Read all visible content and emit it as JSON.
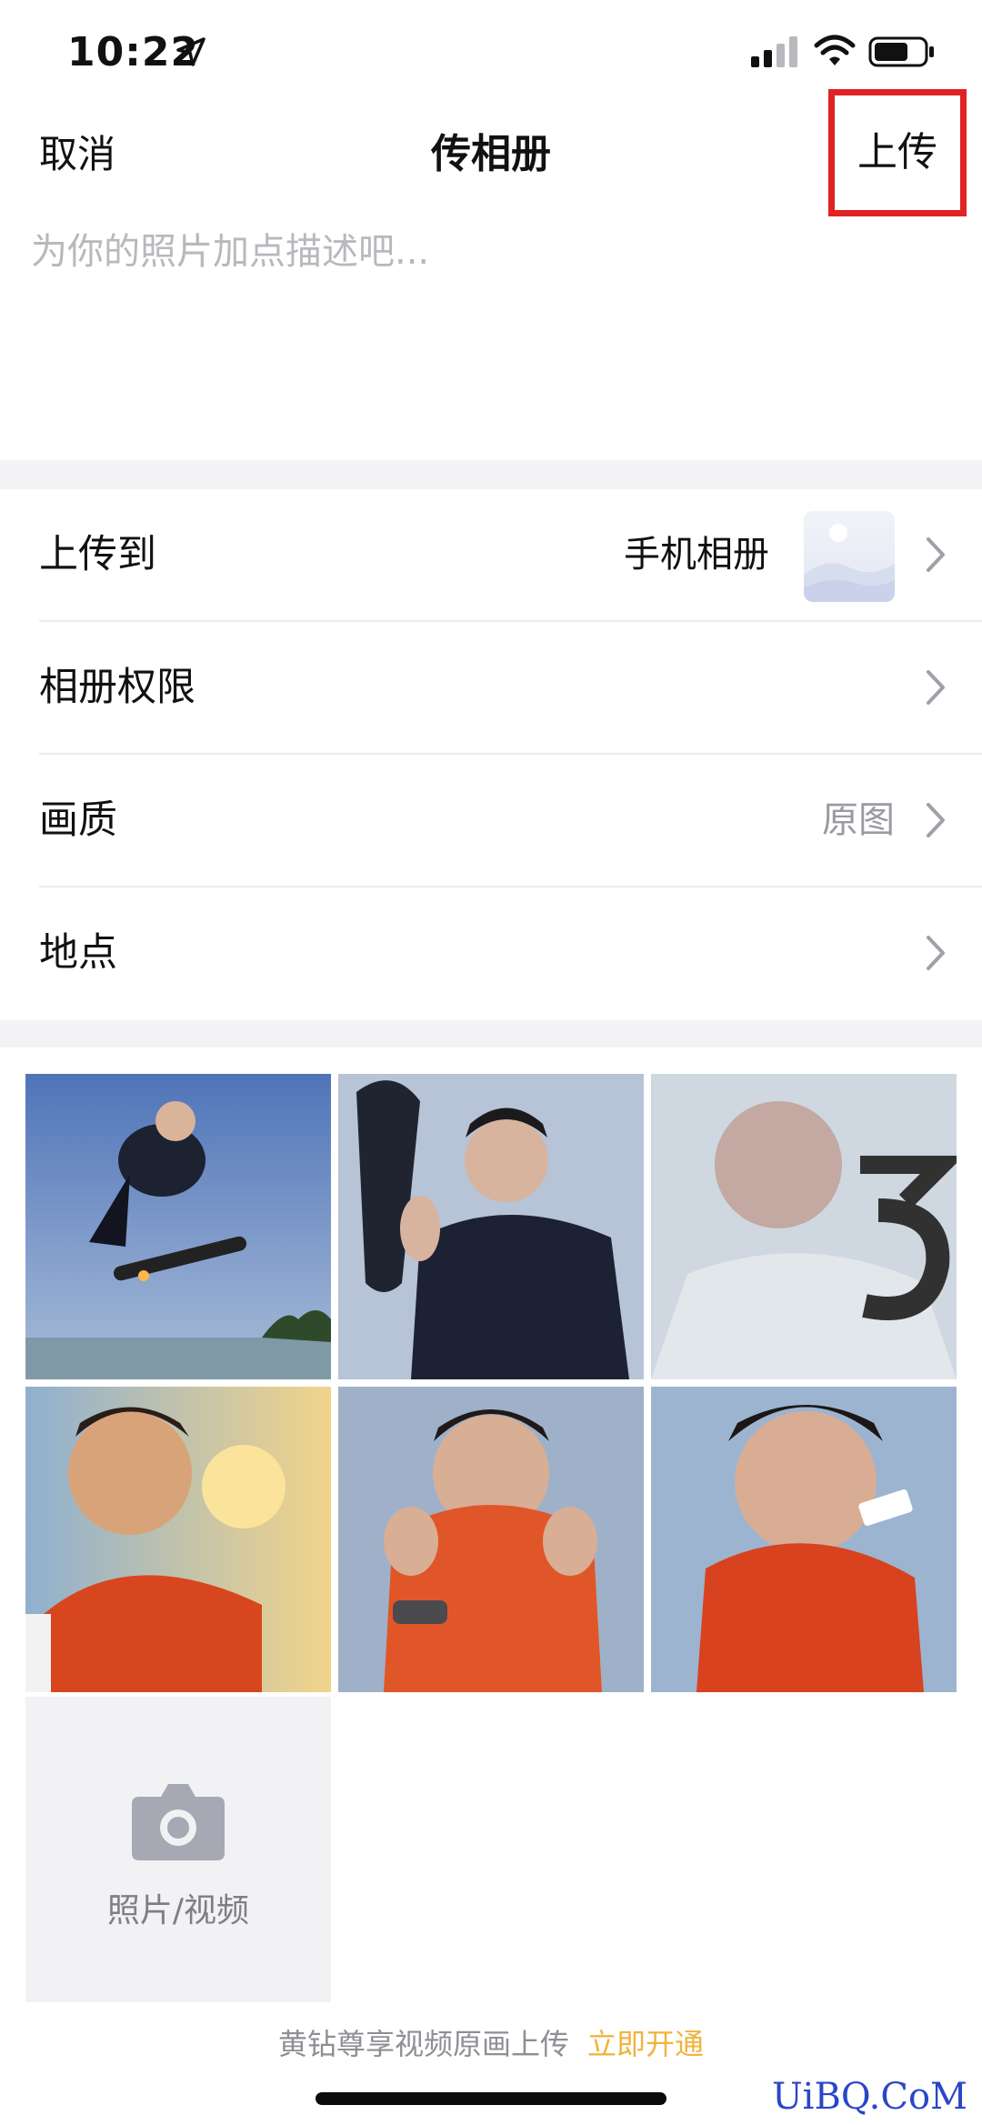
{
  "status_bar": {
    "time": "10:22"
  },
  "nav": {
    "cancel": "取消",
    "title": "传相册",
    "upload": "上传"
  },
  "description": {
    "placeholder": "为你的照片加点描述吧..."
  },
  "settings": [
    {
      "label": "上传到",
      "value": "手机相册"
    },
    {
      "label": "相册权限",
      "value": ""
    },
    {
      "label": "画质",
      "value": "原图"
    },
    {
      "label": "地点",
      "value": ""
    }
  ],
  "photos_count_selected": 6,
  "add_media": {
    "label": "照片/视频"
  },
  "promo": {
    "text": "黄钻尊享视频原画上传",
    "link": "立即开通"
  },
  "watermark": "UiBQ.CoM",
  "colors": {
    "highlight_box": "#e02323",
    "promo_link": "#f0b43c",
    "secondary_text": "#8e8e95",
    "section_bg": "#f3f3f6"
  },
  "icons": {
    "status": [
      "location-arrow-icon",
      "signal-icon",
      "wifi-icon",
      "battery-icon"
    ],
    "row": "chevron-right-icon",
    "add": "camera-icon"
  }
}
